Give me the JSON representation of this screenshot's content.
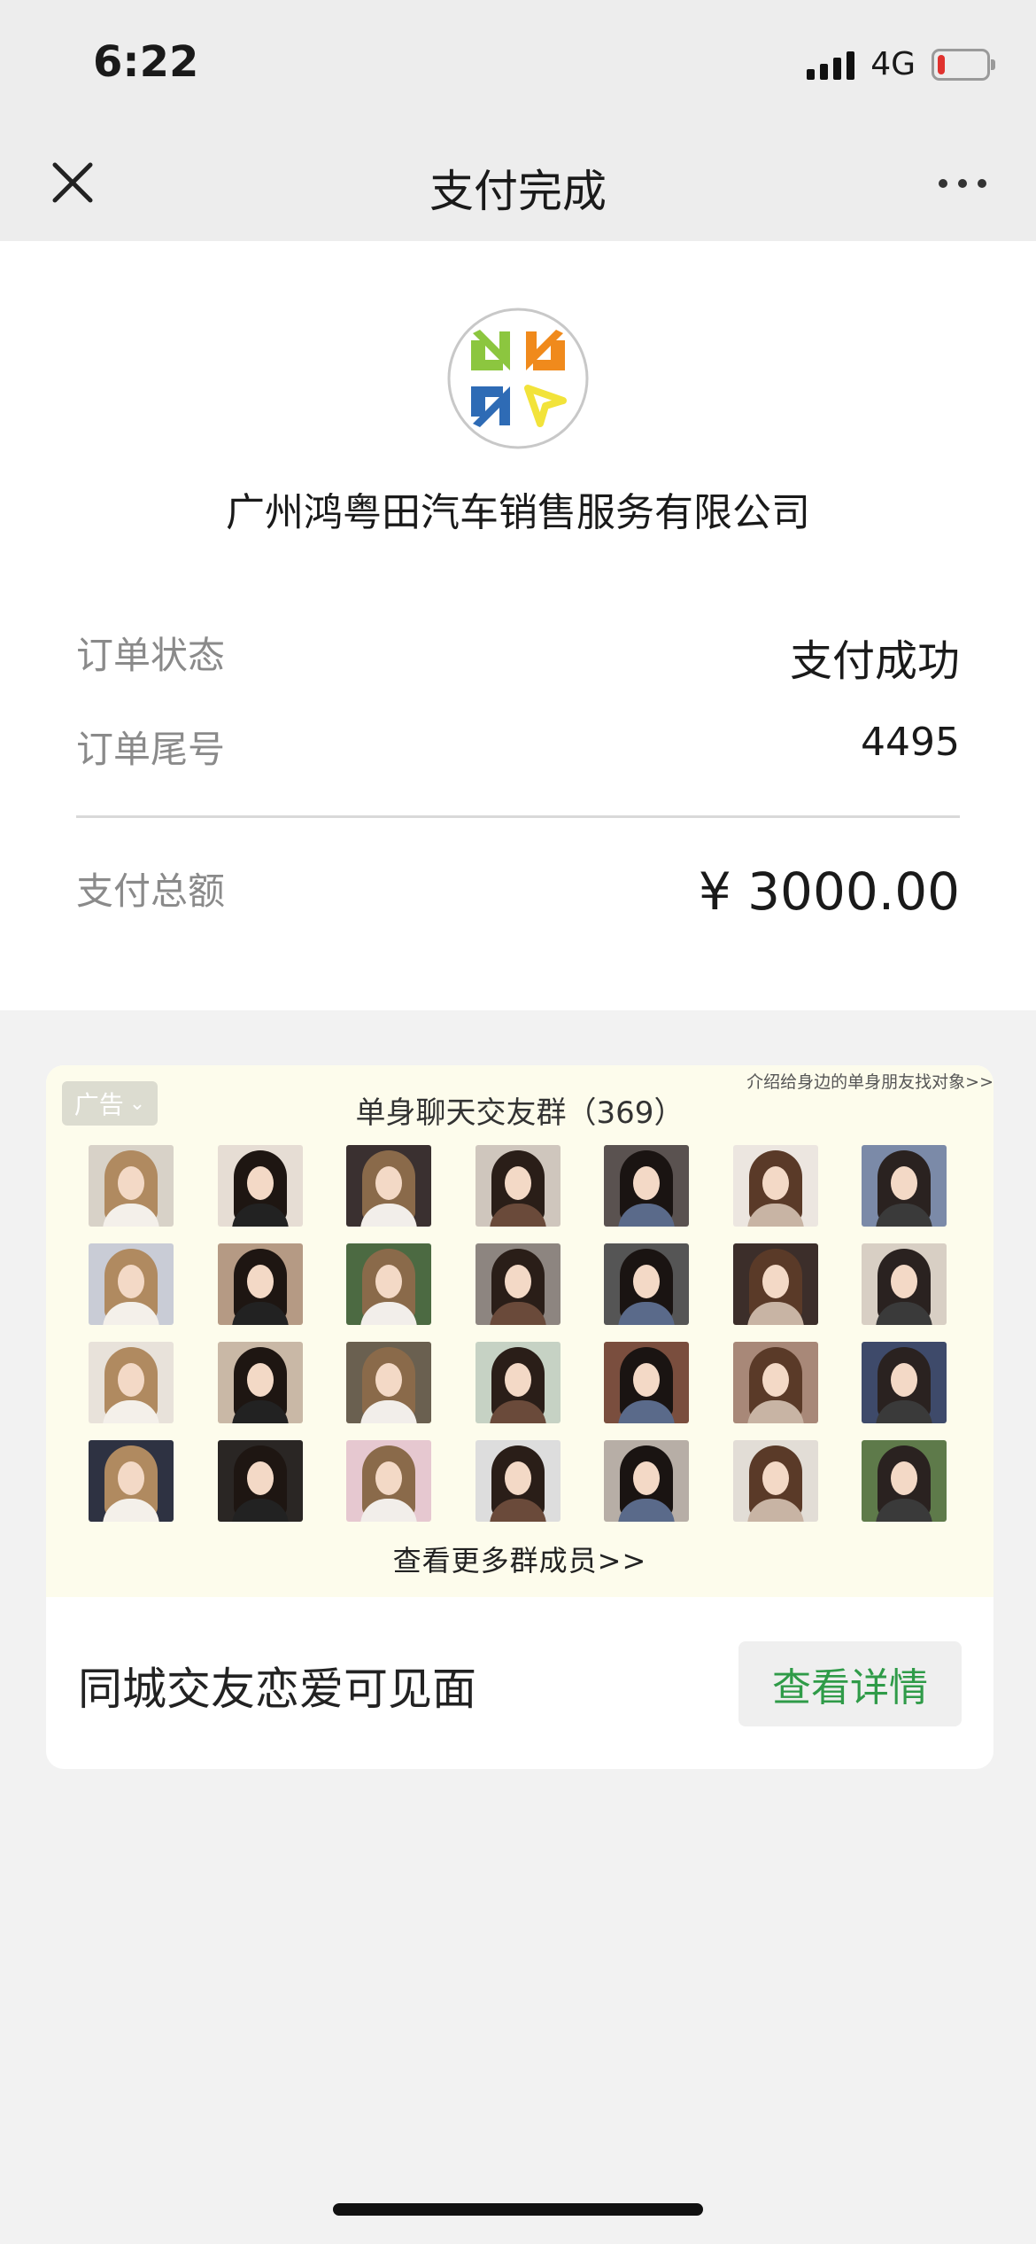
{
  "status_bar": {
    "time": "6:22",
    "network": "4G",
    "battery_level": 0.15,
    "battery_color": "#e0322e"
  },
  "nav": {
    "title": "支付完成",
    "close_icon": "close-icon",
    "more_icon": "more-icon"
  },
  "merchant": {
    "name": "广州鸿粤田汽车销售服务有限公司",
    "logo_colors": [
      "#f08a1c",
      "#8cc63f",
      "#f2e33a",
      "#2e6bb5"
    ]
  },
  "order": {
    "status_label": "订单状态",
    "status_value": "支付成功",
    "tail_label": "订单尾号",
    "tail_value": "4495",
    "total_label": "支付总额",
    "total_value": "¥ 3000.00"
  },
  "ad": {
    "badge": "广告",
    "title": "单身聊天交友群（369）",
    "note": "介绍给身边的单身朋友找对象>>",
    "more_link": "查看更多群成员>>",
    "headline": "同城交友恋爱可见面",
    "button": "查看详情",
    "button_color": "#2f9b48",
    "member_count": 28
  }
}
